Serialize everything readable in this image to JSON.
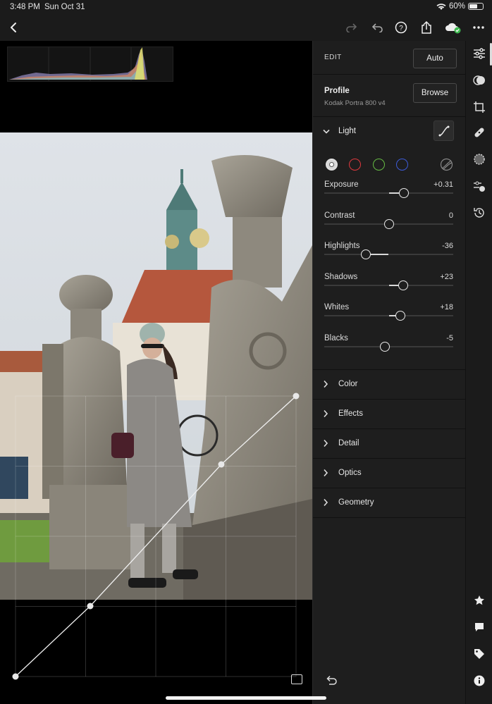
{
  "status_bar": {
    "time": "3:48 PM",
    "date": "Sun Oct 31",
    "battery": "60%",
    "battery_level": 0.6
  },
  "toolbar": {
    "left_icons": [
      "back-chevron-icon"
    ],
    "right_icons": [
      "redo-icon",
      "undo-icon",
      "help-icon",
      "share-icon",
      "cloud-sync-icon",
      "more-icon"
    ]
  },
  "edit_panel": {
    "header": {
      "label": "EDIT",
      "auto_button": "Auto"
    },
    "profile": {
      "label": "Profile",
      "name": "Kodak Portra 800 v4",
      "browse_button": "Browse"
    },
    "light": {
      "title": "Light",
      "curve_channels": [
        "white",
        "red",
        "green",
        "blue"
      ],
      "channel_colors": [
        "#e0e0e0",
        "#e0393e",
        "#66bb44",
        "#3d5bd8"
      ],
      "sliders": [
        {
          "name": "Exposure",
          "value": "+0.31",
          "level": 0.62
        },
        {
          "name": "Contrast",
          "value": "0",
          "level": 0.5
        },
        {
          "name": "Highlights",
          "value": "-36",
          "level": 0.32
        },
        {
          "name": "Shadows",
          "value": "+23",
          "level": 0.61
        },
        {
          "name": "Whites",
          "value": "+18",
          "level": 0.59
        },
        {
          "name": "Blacks",
          "value": "-5",
          "level": 0.47
        }
      ]
    },
    "sections": [
      "Color",
      "Effects",
      "Detail",
      "Optics",
      "Geometry"
    ]
  },
  "rail_icons": [
    "edit-sliders-icon",
    "presets-icon",
    "crop-icon",
    "healing-icon",
    "masking-icon",
    "selective-icon",
    "history-icon",
    "star-icon",
    "comment-icon",
    "tag-icon",
    "info-icon"
  ],
  "colors": {
    "panel_bg": "#1e1e1e",
    "toolbar_bg": "#1b1b1b",
    "accent": "#e8e8e8",
    "cloud_check": "#3fb950"
  }
}
